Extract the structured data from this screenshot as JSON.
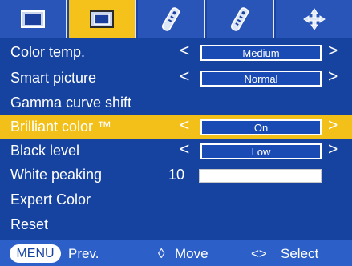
{
  "tabs": [
    {
      "icon": "picture-screen-icon",
      "active": false
    },
    {
      "icon": "picture-screen-framed-icon",
      "active": true
    },
    {
      "icon": "remote-control-icon",
      "active": false
    },
    {
      "icon": "remote-control-settings-icon",
      "active": false
    },
    {
      "icon": "move-arrows-icon",
      "active": false
    }
  ],
  "menu": {
    "rows": [
      {
        "label": "Color temp.",
        "value": "Medium"
      },
      {
        "label": "Smart picture",
        "value": "Normal"
      },
      {
        "label": "Gamma curve shift"
      },
      {
        "label": "Brilliant color ™",
        "value": "On",
        "selected": true
      },
      {
        "label": "Black level",
        "value": "Low"
      },
      {
        "label": "White peaking",
        "number": "10",
        "level_fraction": 0.0
      },
      {
        "label": "Expert Color"
      },
      {
        "label": "Reset"
      }
    ],
    "arrow_left": "<",
    "arrow_right": ">"
  },
  "footer": {
    "menu_key": "MENU",
    "prev": "Prev.",
    "move_symbol": "◊",
    "move": "Move",
    "select_symbol": "<>",
    "select": "Select"
  },
  "colors": {
    "menu_bg": "#1643a0",
    "selected_bg": "#f2c019",
    "footer_bg": "#2d5fc9",
    "tab_bg": "#2a55b8",
    "tab_active": "#f4c21a"
  }
}
